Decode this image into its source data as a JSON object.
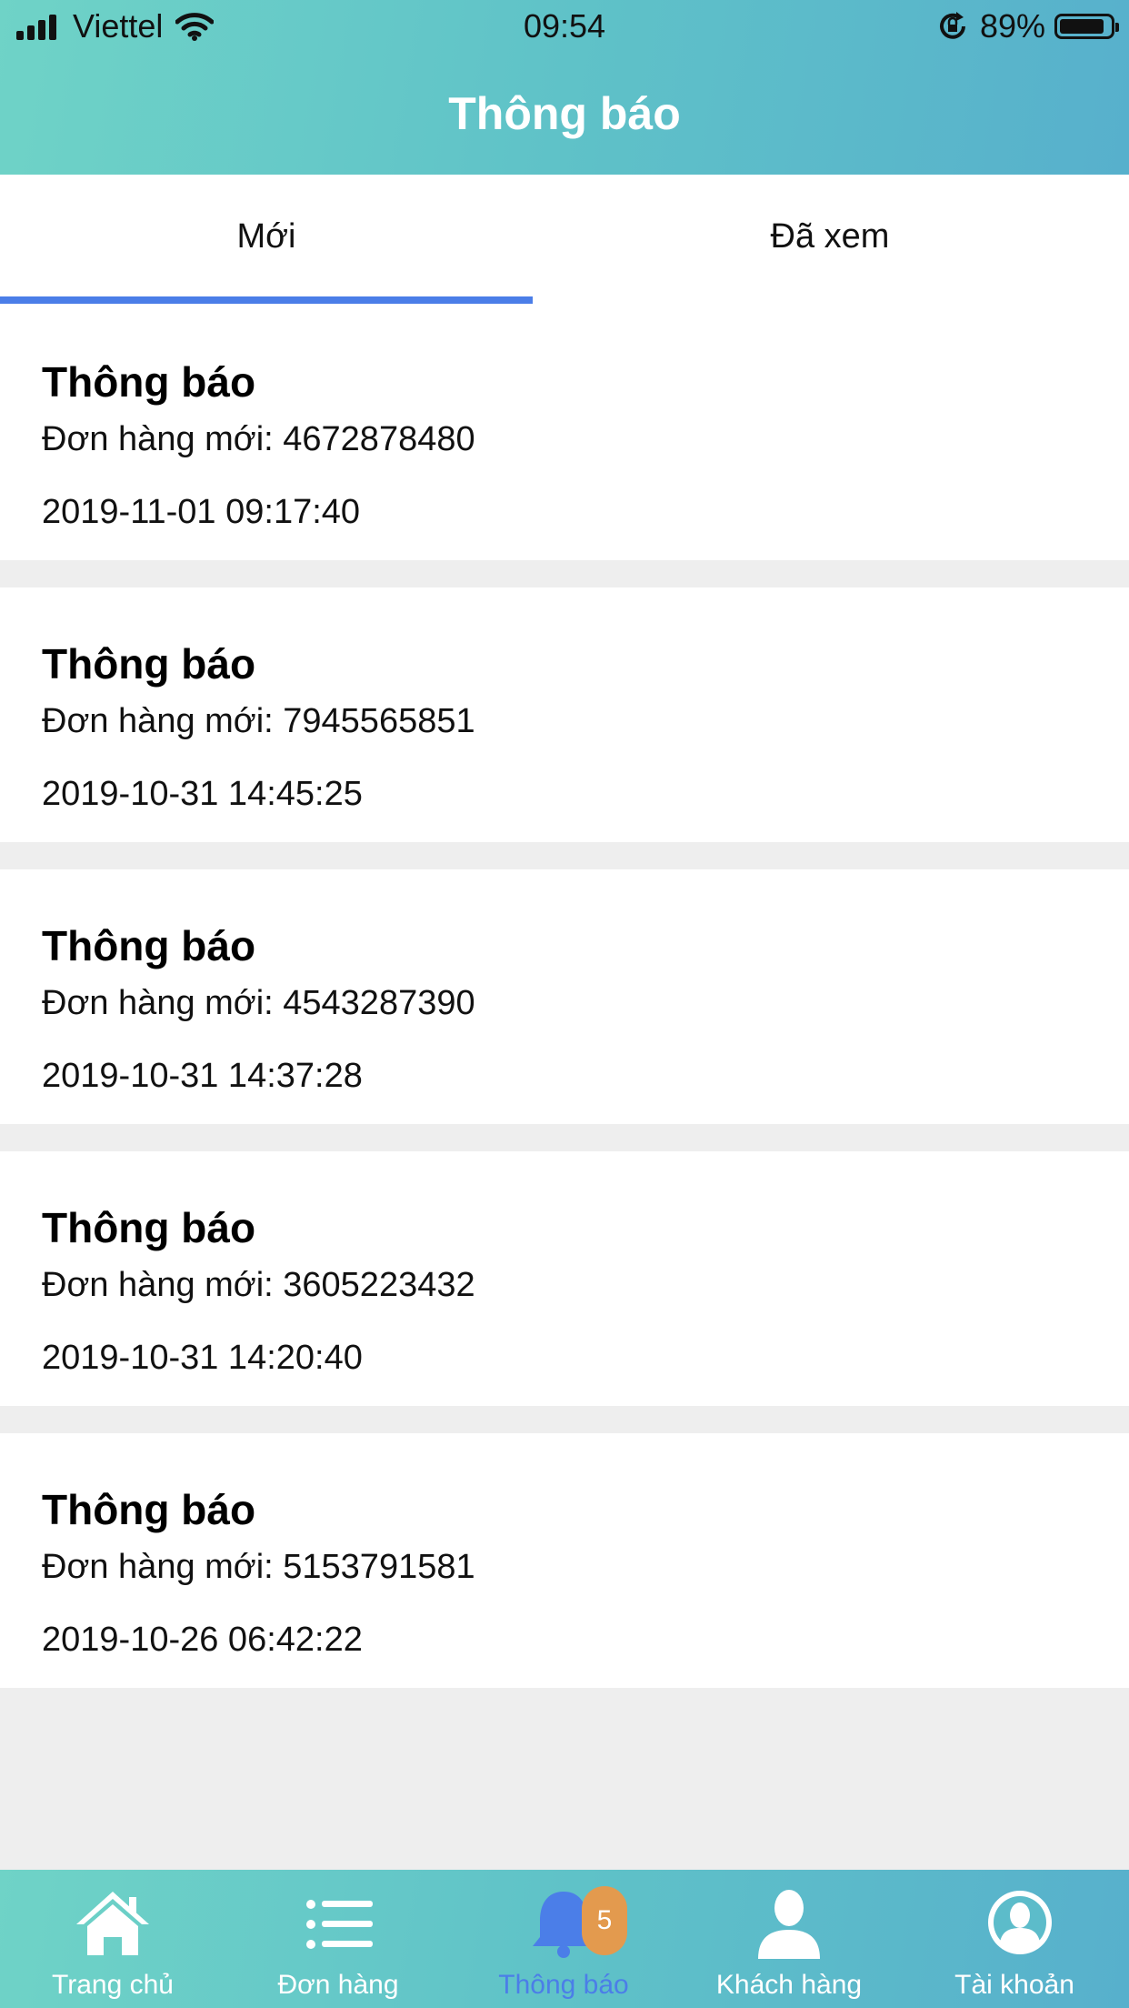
{
  "status_bar": {
    "carrier": "Viettel",
    "time": "09:54",
    "battery": "89%",
    "battery_level": 0.89
  },
  "header": {
    "title": "Thông báo"
  },
  "tabs": [
    {
      "label": "Mới",
      "active": true
    },
    {
      "label": "Đã xem",
      "active": false
    }
  ],
  "notifications": [
    {
      "title": "Thông báo",
      "message": "Đơn hàng mới: 4672878480",
      "time": "2019-11-01 09:17:40"
    },
    {
      "title": "Thông báo",
      "message": "Đơn hàng mới: 7945565851",
      "time": "2019-10-31 14:45:25"
    },
    {
      "title": "Thông báo",
      "message": "Đơn hàng mới: 4543287390",
      "time": "2019-10-31 14:37:28"
    },
    {
      "title": "Thông báo",
      "message": "Đơn hàng mới: 3605223432",
      "time": "2019-10-31 14:20:40"
    },
    {
      "title": "Thông báo",
      "message": "Đơn hàng mới: 5153791581",
      "time": "2019-10-26 06:42:22"
    }
  ],
  "tab_bar": {
    "items": [
      {
        "label": "Trang chủ",
        "icon": "home-icon"
      },
      {
        "label": "Đơn hàng",
        "icon": "list-icon"
      },
      {
        "label": "Thông báo",
        "icon": "bell-icon",
        "active": true
      },
      {
        "label": "Khách hàng",
        "icon": "person-icon"
      },
      {
        "label": "Tài khoản",
        "icon": "account-icon"
      }
    ],
    "badge_count": "5"
  },
  "colors": {
    "accent": "#4b7ee8",
    "header_gradient_start": "#6fd3c7",
    "header_gradient_end": "#57b0cc",
    "badge": "#e39a4e"
  }
}
